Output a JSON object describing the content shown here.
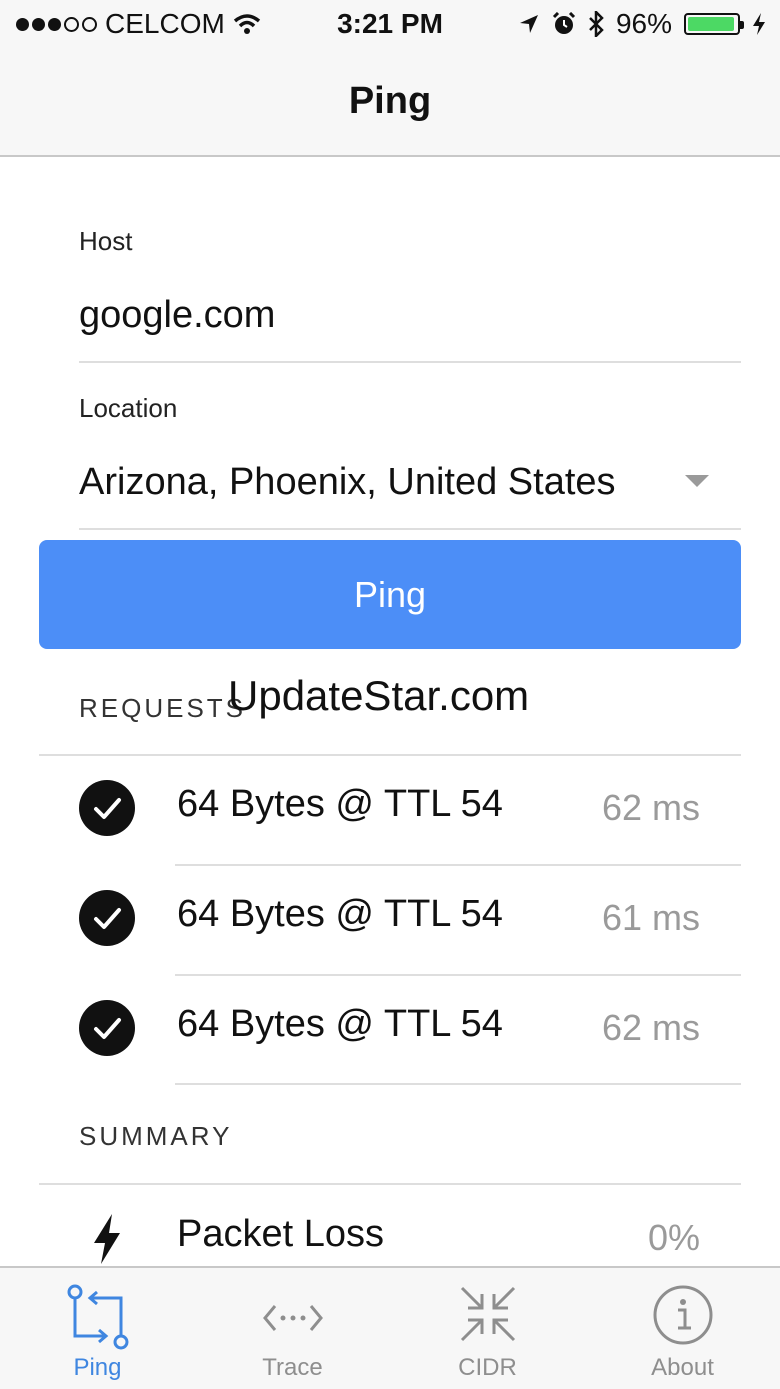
{
  "status_bar": {
    "carrier": "CELCOM",
    "time": "3:21 PM",
    "battery": "96%",
    "battery_level": 0.96,
    "signal_bars": 3,
    "colors": {
      "battery": "#4cd964"
    },
    "icons": [
      "wifi-icon",
      "location-arrow-icon",
      "alarm-icon",
      "bluetooth-icon",
      "charging-bolt-icon"
    ]
  },
  "nav": {
    "title": "Ping"
  },
  "form": {
    "host_label": "Host",
    "host_value": "google.com",
    "location_label": "Location",
    "location_value": "Arizona, Phoenix, United States"
  },
  "ping_button": {
    "label": "Ping",
    "color": "#4c8ef7"
  },
  "requests": {
    "header": "REQUESTS",
    "items": [
      {
        "text": "64 Bytes @ TTL 54",
        "time": "62 ms"
      },
      {
        "text": "64 Bytes @ TTL 54",
        "time": "61 ms"
      },
      {
        "text": "64 Bytes @ TTL 54",
        "time": "62 ms"
      }
    ]
  },
  "summary": {
    "header": "SUMMARY",
    "items": [
      {
        "label": "Packet Loss",
        "value": "0%"
      }
    ]
  },
  "tabs": [
    {
      "label": "Ping",
      "icon": "ping-icon",
      "active": true
    },
    {
      "label": "Trace",
      "icon": "trace-icon",
      "active": false
    },
    {
      "label": "CIDR",
      "icon": "cidr-icon",
      "active": false
    },
    {
      "label": "About",
      "icon": "info-icon",
      "active": false
    }
  ],
  "watermark": "UpdateStar.com"
}
